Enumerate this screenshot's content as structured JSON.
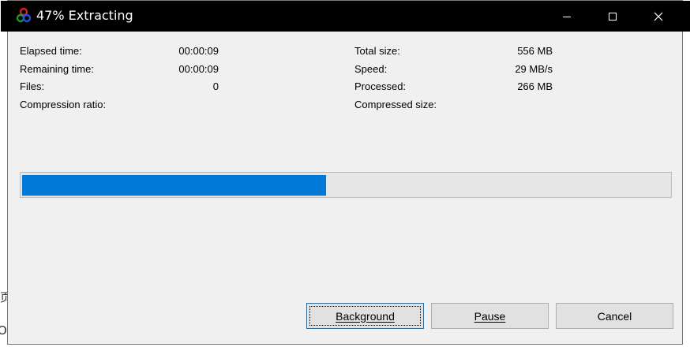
{
  "window": {
    "title": "47% Extracting",
    "progress_fraction": 0.47
  },
  "stats_left": [
    {
      "label": "Elapsed time:",
      "value": "00:00:09"
    },
    {
      "label": "Remaining time:",
      "value": "00:00:09"
    },
    {
      "label": "Files:",
      "value": "0"
    },
    {
      "label": "Compression ratio:",
      "value": ""
    }
  ],
  "stats_right": [
    {
      "label": "Total size:",
      "value": "556 MB"
    },
    {
      "label": "Speed:",
      "value": "29 MB/s"
    },
    {
      "label": "Processed:",
      "value": "266 MB"
    },
    {
      "label": "Compressed size:",
      "value": ""
    }
  ],
  "buttons": {
    "background": "Background",
    "pause": "Pause",
    "cancel": "Cancel"
  },
  "background_glyphs": {
    "g1": "页",
    "g2": "Op"
  },
  "colors": {
    "titlebar": "#000000",
    "progress": "#0078d7",
    "window_bg": "#f0f0f0"
  }
}
